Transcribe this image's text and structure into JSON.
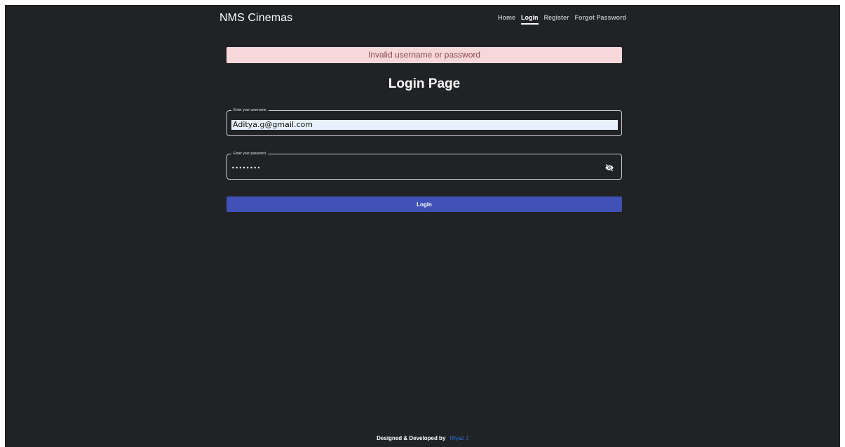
{
  "header": {
    "brand": "NMS Cinemas",
    "nav": [
      {
        "label": "Home",
        "active": false
      },
      {
        "label": "Login",
        "active": true
      },
      {
        "label": "Register",
        "active": false
      },
      {
        "label": "Forgot Password",
        "active": false
      }
    ]
  },
  "alert": {
    "message": "Invalid username or password",
    "color": "#f8d7da"
  },
  "main": {
    "title": "Login Page",
    "username": {
      "label": "Enter your username",
      "value": "Aditya.g@gmail.com"
    },
    "password": {
      "label": "Enter your password",
      "value": "••••••••",
      "toggle_icon": "eye-slash-icon"
    },
    "submit_label": "Login",
    "accent_color": "#3f51b5"
  },
  "footer": {
    "text": "Designed & Developed by",
    "author": "Riyaz J"
  }
}
